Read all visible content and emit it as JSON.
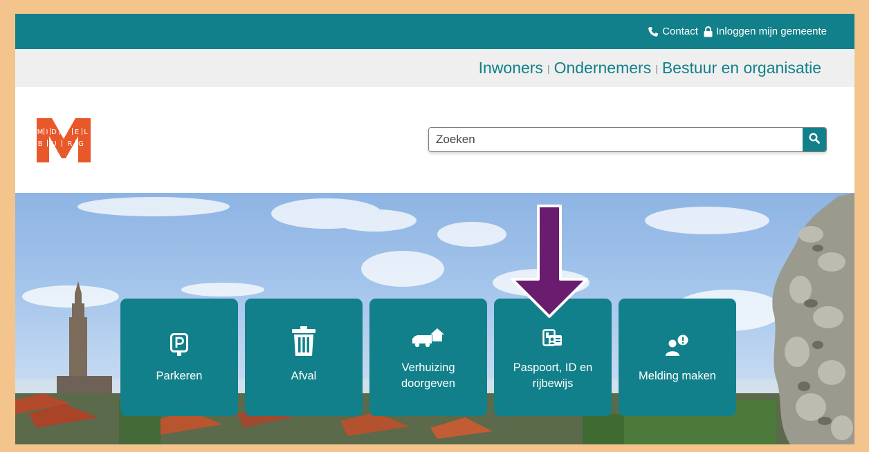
{
  "topbar": {
    "contact_label": "Contact",
    "login_label": "Inloggen mijn gemeente"
  },
  "audience_nav": [
    {
      "label": "Inwoners"
    },
    {
      "label": "Ondernemers"
    },
    {
      "label": "Bestuur en organisatie"
    }
  ],
  "audience_separator": "|",
  "logo": {
    "top_text": "MIDDEL",
    "bottom_text": "BURG",
    "color": "#e8582a"
  },
  "search": {
    "placeholder": "Zoeken",
    "value": ""
  },
  "tiles": [
    {
      "label": "Parkeren",
      "icon": "parking-icon"
    },
    {
      "label": "Afval",
      "icon": "trash-icon"
    },
    {
      "label": "Verhuizing doorgeven",
      "icon": "moving-truck-icon"
    },
    {
      "label": "Paspoort, ID en rijbewijs",
      "icon": "id-card-icon"
    },
    {
      "label": "Melding maken",
      "icon": "report-person-icon"
    }
  ],
  "colors": {
    "brand_teal": "#12808a",
    "arrow_purple": "#6a1d6e",
    "page_frame": "#f3c58c"
  }
}
